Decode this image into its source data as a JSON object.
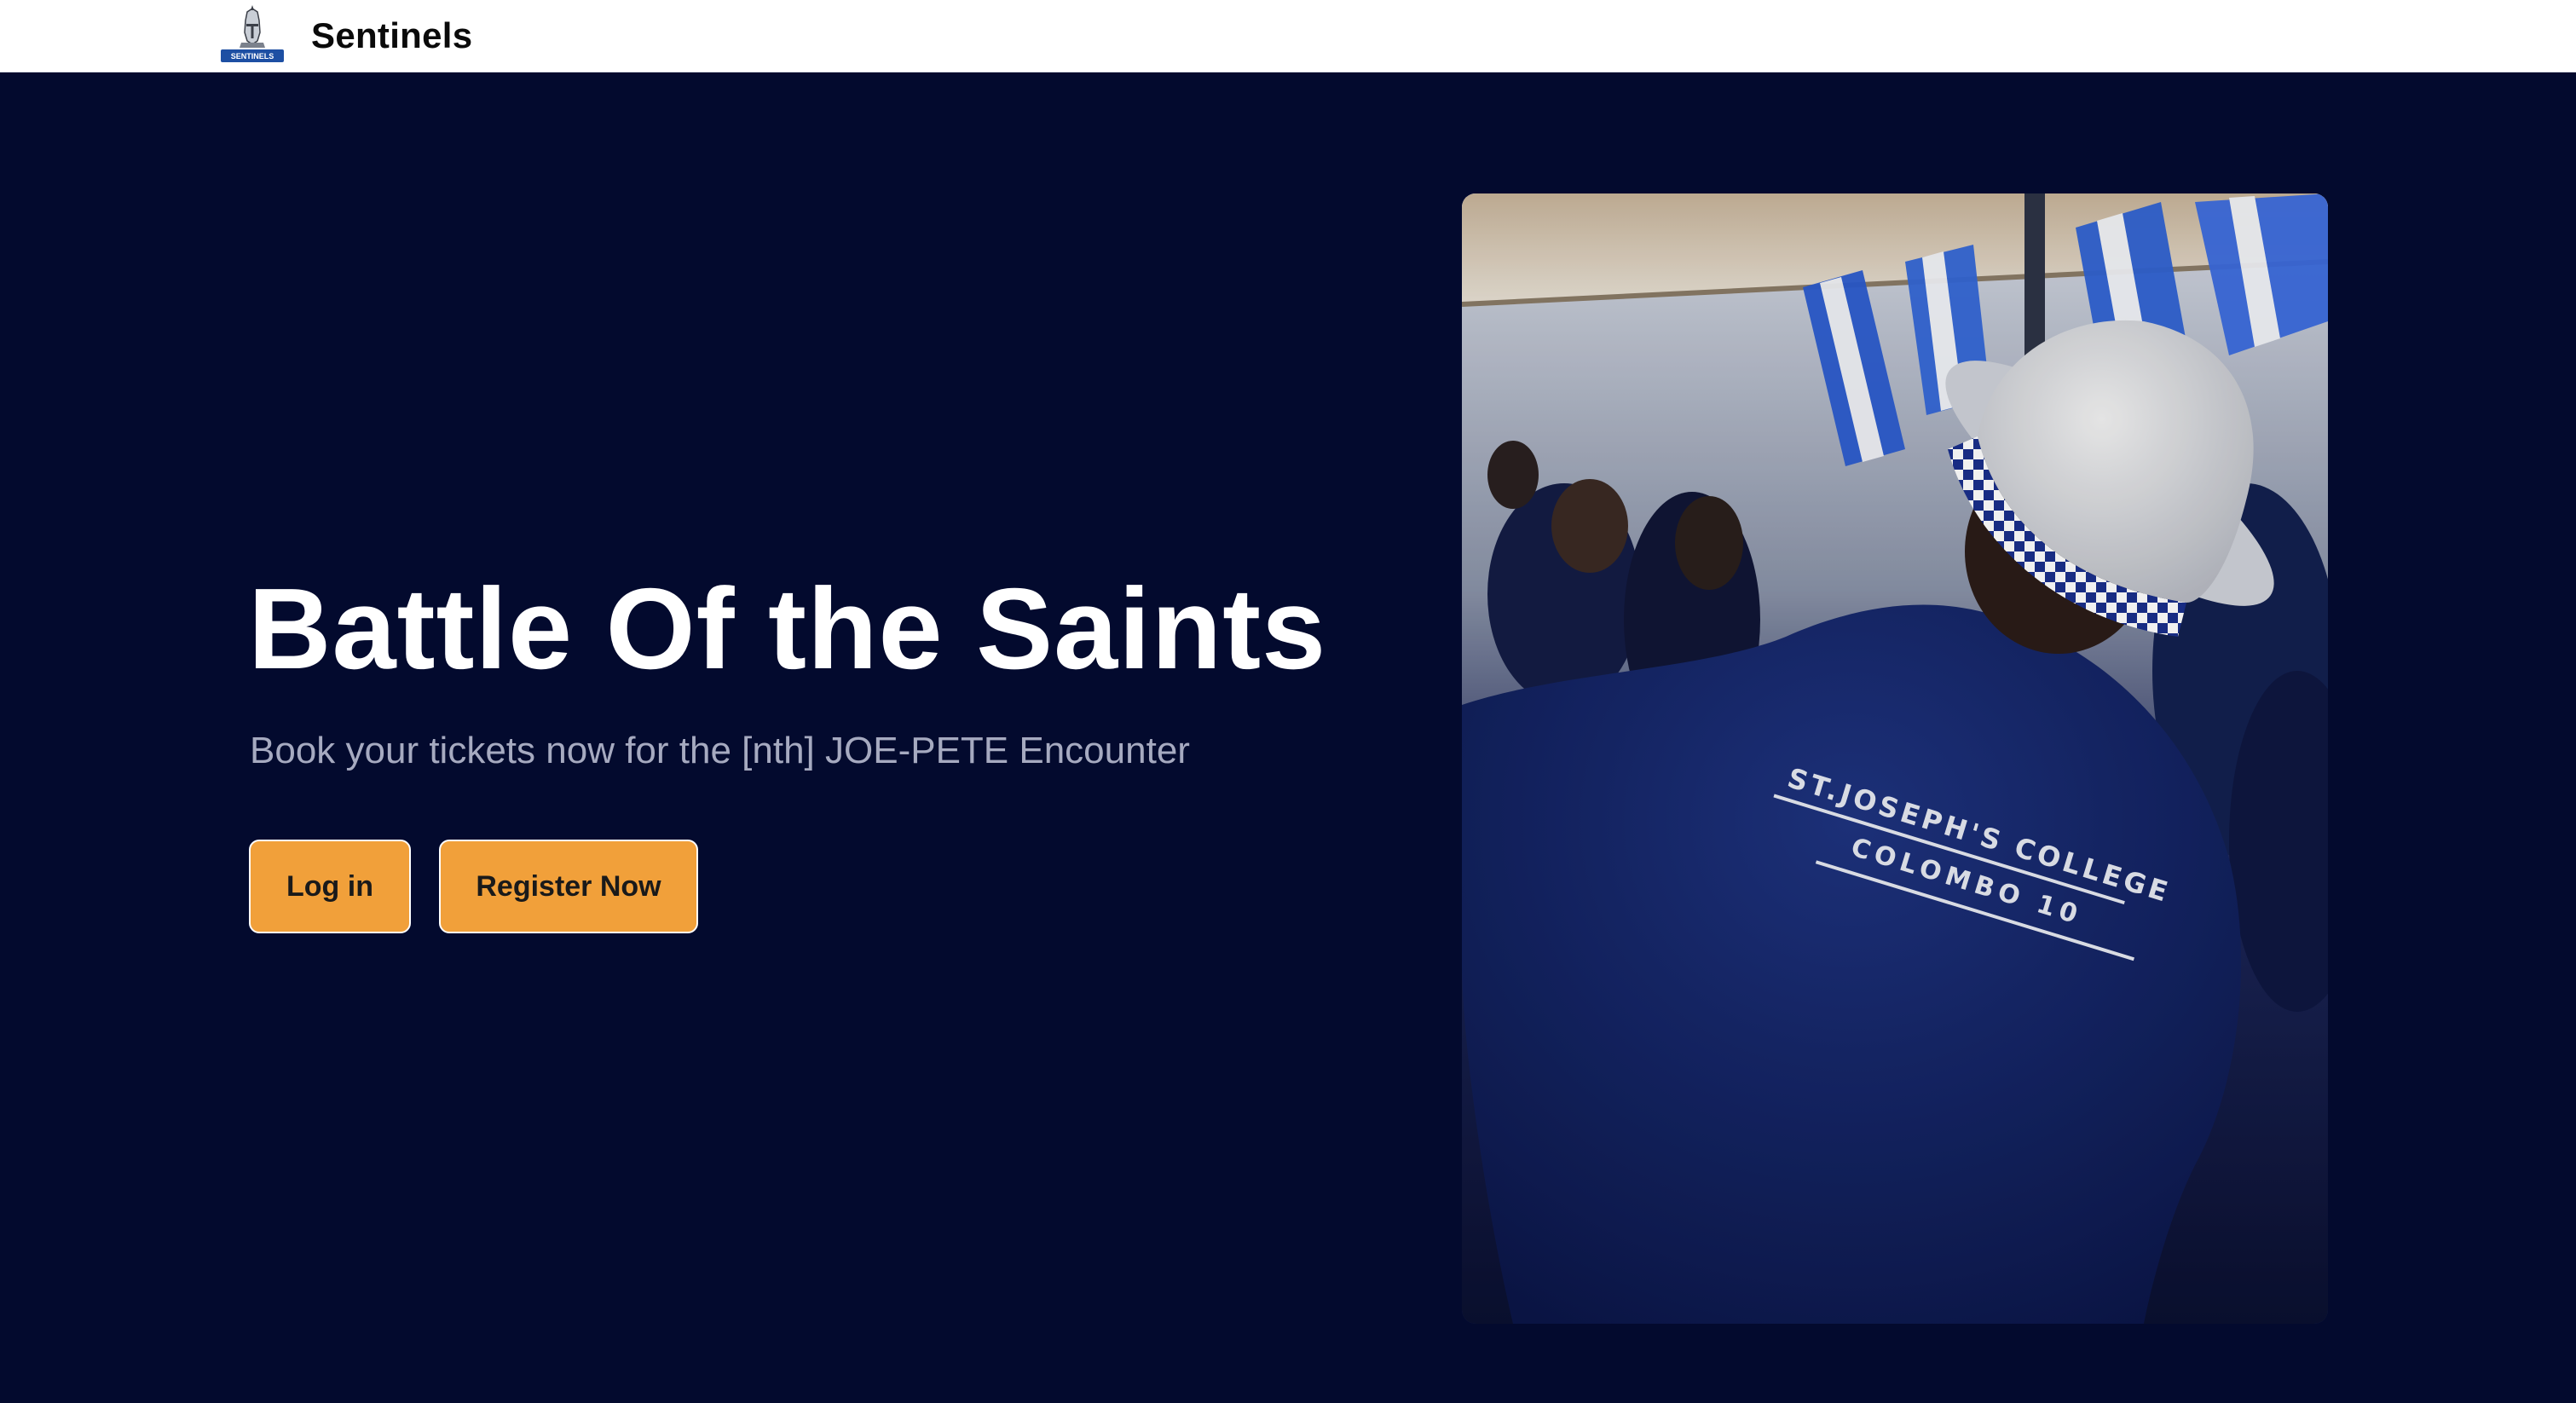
{
  "navbar": {
    "brand_name": "Sentinels",
    "logo_icon": "knight-helmet-crest-icon",
    "logo_banner_text": "SENTINELS"
  },
  "hero": {
    "title": "Battle Of the Saints",
    "subtitle": "Book your tickets now for the [nth] JOE-PETE Encounter",
    "buttons": {
      "login_label": "Log in",
      "register_label": "Register Now"
    },
    "image": {
      "shirt_text_line1": "ST.JOSEPH'S COLLEGE",
      "shirt_text_line2": "COLOMBO 10"
    }
  },
  "colors": {
    "page_background": "#030a2e",
    "navbar_background": "#ffffff",
    "button_accent": "#f1a03a",
    "title_text": "#ffffff",
    "subtitle_text": "#a6aac0"
  }
}
